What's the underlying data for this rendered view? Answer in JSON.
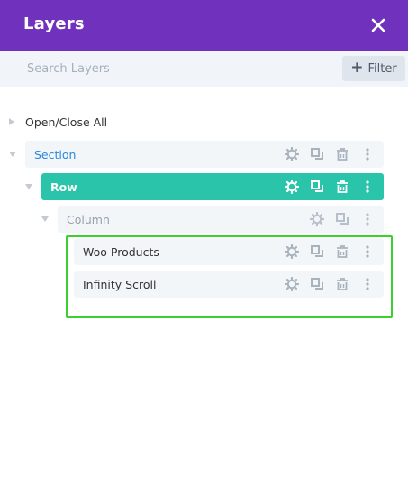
{
  "header": {
    "title": "Layers",
    "close_icon": "close-icon"
  },
  "search": {
    "placeholder": "Search Layers",
    "value": ""
  },
  "filter": {
    "label": "Filter",
    "icon": "plus-icon"
  },
  "open_close": {
    "label": "Open/Close All"
  },
  "tree": {
    "section": {
      "label": "Section"
    },
    "row": {
      "label": "Row"
    },
    "column": {
      "label": "Column"
    },
    "modules": [
      {
        "label": "Woo Products"
      },
      {
        "label": "Infinity Scroll"
      }
    ]
  },
  "colors": {
    "header_bg": "#7032bd",
    "row_bg": "#29c4a9",
    "section_text": "#2b87da",
    "highlight": "#3ad12f"
  }
}
